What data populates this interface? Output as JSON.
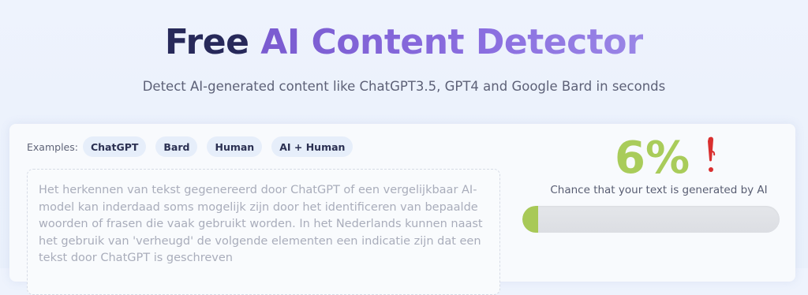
{
  "header": {
    "title_plain": "Free",
    "title_highlight": "AI Content Detector",
    "subtitle": "Detect AI-generated content like ChatGPT3.5, GPT4 and Google Bard in seconds"
  },
  "examples": {
    "label": "Examples:",
    "chips": [
      "ChatGPT",
      "Bard",
      "Human",
      "AI + Human"
    ]
  },
  "input": {
    "placeholder": "Het herkennen van tekst gegenereerd door ChatGPT of een vergelijkbaar AI-model kan inderdaad soms mogelijk zijn door het identificeren van bepaalde woorden of frasen die vaak gebruikt worden. In het Nederlands kunnen naast het gebruik van 'verheugd' de volgende elementen een indicatie zijn dat een tekst door ChatGPT is geschreven"
  },
  "result": {
    "score_text": "6%",
    "score_fraction": 0.06,
    "caption": "Chance that your text is generated by AI",
    "score_color": "#a9cc5a",
    "alert_icon": "red-exclamation-mark-icon"
  },
  "colors": {
    "title_dark": "#27295a",
    "title_accent": "#7a5bd0",
    "bar_fill": "#a8c957"
  }
}
